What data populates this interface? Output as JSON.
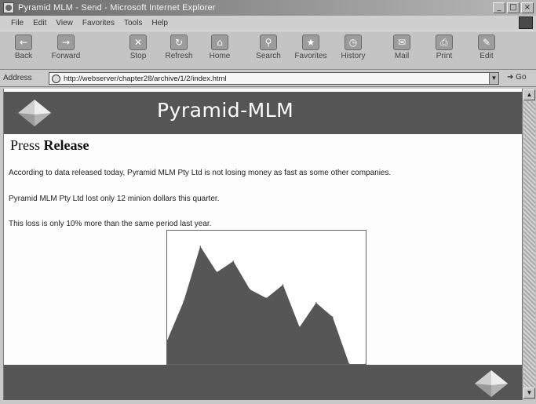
{
  "window": {
    "title": "Pyramid MLM - Send - Microsoft Internet Explorer",
    "controls": {
      "minimize": "_",
      "maximize": "□",
      "close": "×"
    }
  },
  "menu": {
    "items": [
      "File",
      "Edit",
      "View",
      "Favorites",
      "Tools",
      "Help"
    ]
  },
  "toolbar": {
    "buttons": [
      {
        "label": "Back",
        "icon": "back-arrow-icon",
        "glyph": "←"
      },
      {
        "label": "Forward",
        "icon": "forward-arrow-icon",
        "glyph": "→"
      },
      {
        "label": "Stop",
        "icon": "stop-icon",
        "glyph": "✕"
      },
      {
        "label": "Refresh",
        "icon": "refresh-icon",
        "glyph": "↻"
      },
      {
        "label": "Home",
        "icon": "home-icon",
        "glyph": "⌂"
      },
      {
        "label": "Search",
        "icon": "search-icon",
        "glyph": "⚲"
      },
      {
        "label": "Favorites",
        "icon": "favorites-icon",
        "glyph": "★"
      },
      {
        "label": "History",
        "icon": "history-icon",
        "glyph": "◷"
      },
      {
        "label": "Mail",
        "icon": "mail-icon",
        "glyph": "✉"
      },
      {
        "label": "Print",
        "icon": "print-icon",
        "glyph": "⎙"
      },
      {
        "label": "Edit",
        "icon": "edit-icon",
        "glyph": "✎"
      }
    ]
  },
  "address": {
    "label": "Address",
    "url": "http://webserver/chapter28/archive/1/2/index.html",
    "go_label": "Go"
  },
  "page": {
    "site_title": "Pyramid-MLM",
    "heading_plain": "Press",
    "heading_bold": "Release",
    "paragraphs": [
      "According to data released today, Pyramid MLM Pty Ltd is not losing money as fast as some other companies.",
      "Pyramid MLM Pty Ltd lost only 12 minion dollars this quarter.",
      "This loss is only 10% more than the same period last year."
    ]
  },
  "chart_data": {
    "type": "area",
    "x": [
      1,
      2,
      3,
      4,
      5,
      6,
      7,
      8,
      9,
      10,
      11,
      12,
      13
    ],
    "values": [
      30,
      80,
      150,
      117,
      131,
      95,
      84,
      101,
      47,
      78,
      60,
      0,
      0
    ],
    "ylim": [
      0,
      170
    ],
    "title": "",
    "xlabel": "",
    "ylabel": "",
    "grid": false,
    "fill_color": "#565656"
  },
  "colors": {
    "header_band": "#555555",
    "page_bg": "#fdfdfd",
    "chrome": "#c8c8c8"
  }
}
